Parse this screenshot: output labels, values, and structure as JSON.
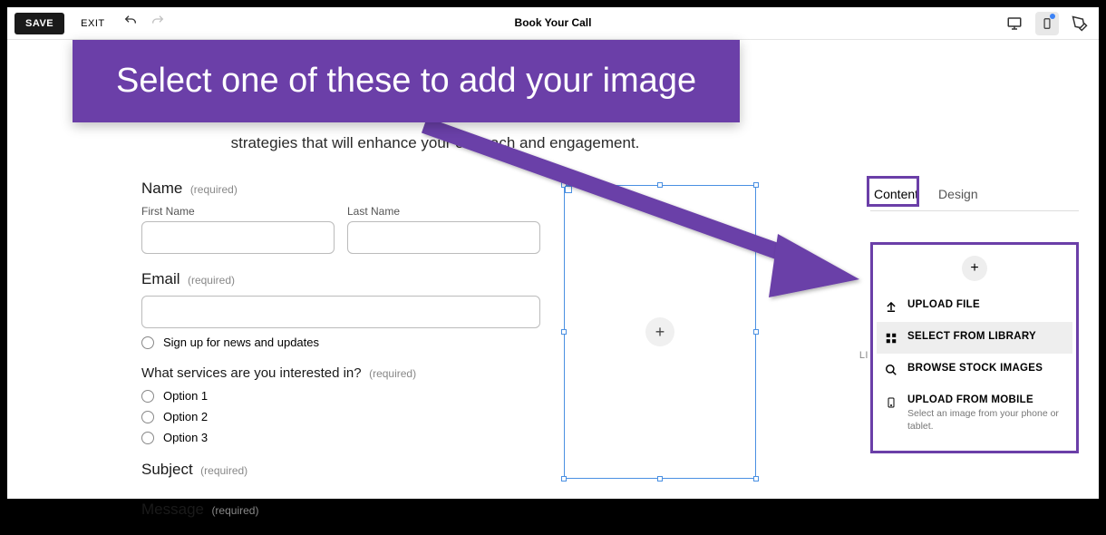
{
  "topbar": {
    "save": "SAVE",
    "exit": "EXIT",
    "title": "Book Your Call"
  },
  "callout": "Select one of these to add your image",
  "intro": "strategies that will enhance your outreach and engagement.",
  "form": {
    "name_label": "Name",
    "name_req": "(required)",
    "first_name": "First Name",
    "last_name": "Last Name",
    "email_label": "Email",
    "email_req": "(required)",
    "signup": "Sign up for news and updates",
    "services_label": "What services are you interested in?",
    "services_req": "(required)",
    "options": [
      "Option 1",
      "Option 2",
      "Option 3"
    ],
    "subject_label": "Subject",
    "subject_req": "(required)",
    "message_label": "Message",
    "message_req": "(required)"
  },
  "panel": {
    "tab_content": "Content",
    "tab_design": "Design",
    "upload_file": "UPLOAD FILE",
    "select_library": "SELECT FROM LIBRARY",
    "browse_stock": "BROWSE STOCK IMAGES",
    "upload_mobile": "UPLOAD FROM MOBILE",
    "upload_mobile_sub": "Select an image from your phone or tablet.",
    "link_label": "LI"
  }
}
